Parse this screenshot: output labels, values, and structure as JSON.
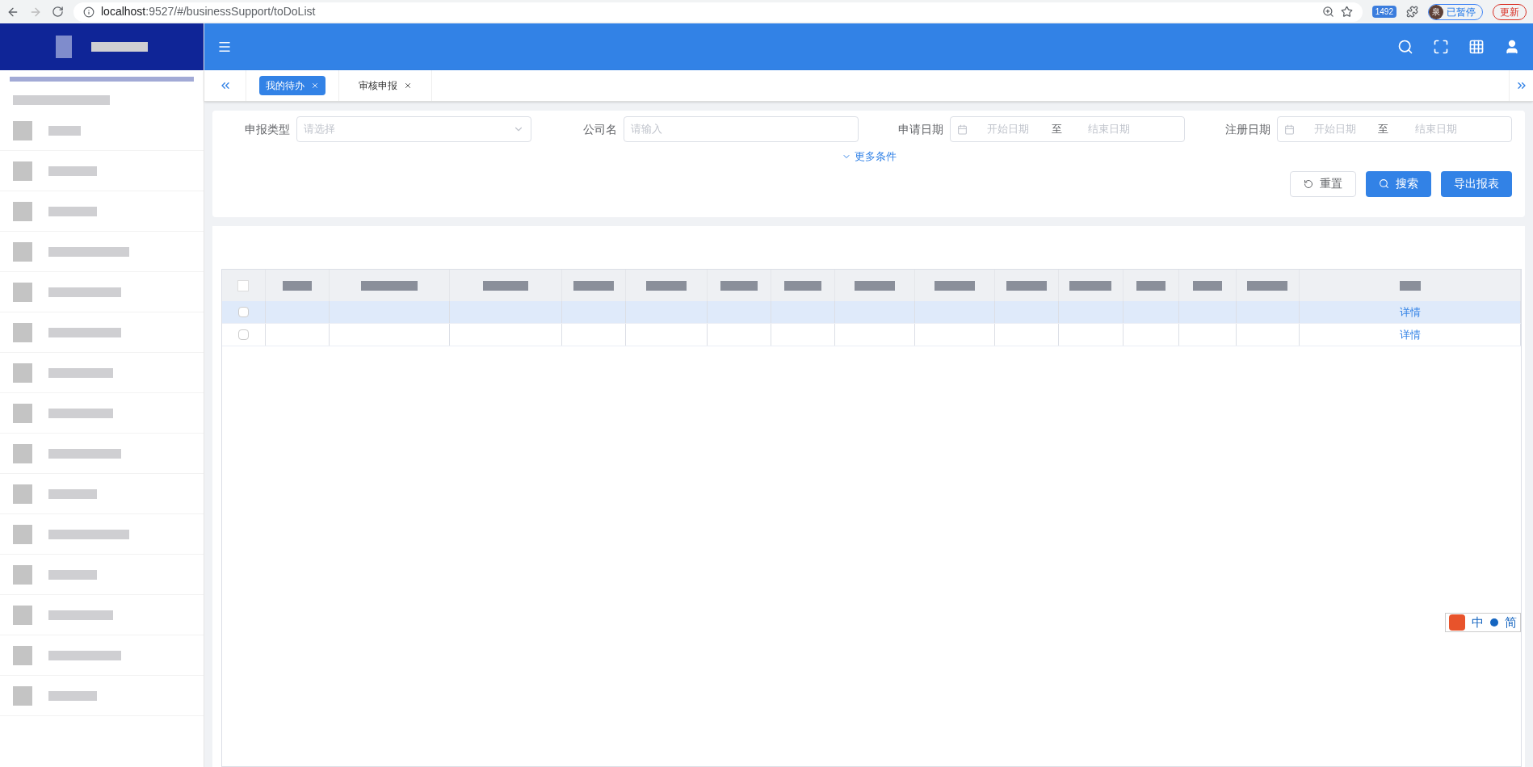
{
  "browser": {
    "url_host": "localhost",
    "url_rest": ":9527/#/businessSupport/toDoList",
    "ext_badge": "1492",
    "profile_initial": "泉",
    "paused": "已暂停",
    "update": "更新"
  },
  "tabs": [
    {
      "label": "我的待办",
      "selected": true
    },
    {
      "label": "审核申报",
      "selected": false
    }
  ],
  "filters": [
    {
      "label": "申报类型",
      "kind": "select",
      "placeholder": "请选择"
    },
    {
      "label": "公司名",
      "kind": "input",
      "placeholder": "请输入"
    },
    {
      "label": "申请日期",
      "kind": "daterange",
      "start": "开始日期",
      "sep": "至",
      "end": "结束日期"
    },
    {
      "label": "注册日期",
      "kind": "daterange",
      "start": "开始日期",
      "sep": "至",
      "end": "结束日期"
    }
  ],
  "more_conditions": "更多条件",
  "buttons": [
    {
      "label": "重置",
      "kind": "plain"
    },
    {
      "label": "搜索",
      "kind": "primary"
    },
    {
      "label": "导出报表",
      "kind": "primary"
    }
  ],
  "table": {
    "all_checked": false,
    "rows": [
      {
        "highlighted": true,
        "checked": false,
        "action": "详情"
      },
      {
        "highlighted": false,
        "checked": false,
        "action": "详情"
      }
    ]
  },
  "ime": {
    "mode": "中",
    "script": "简"
  }
}
